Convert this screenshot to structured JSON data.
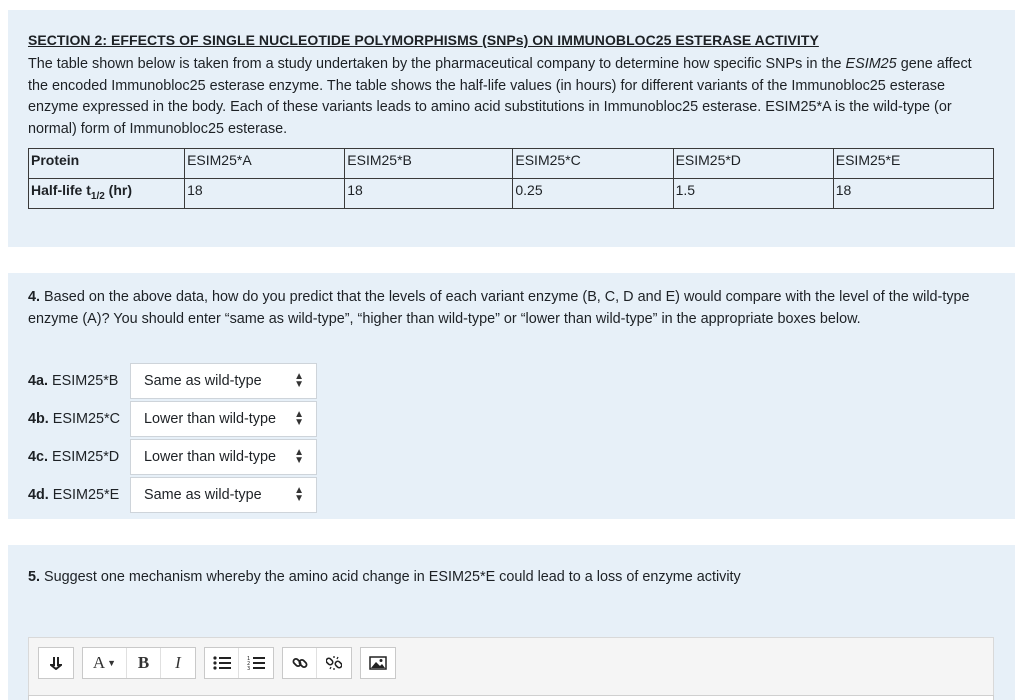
{
  "section2": {
    "title": "SECTION 2: EFFECTS OF SINGLE NUCLEOTIDE POLYMORPHISMS (SNPs) ON IMMUNOBLOC25 ESTERASE ACTIVITY",
    "para_part1": "The table shown below is taken from a study undertaken by the pharmaceutical company to determine how specific SNPs in the ",
    "para_italic": "ESIM25",
    "para_part2": " gene affect the encoded Immunobloc25 esterase enzyme. The table shows the half-life values (in hours) for different variants of the Immunobloc25 esterase enzyme expressed in the body. Each of these variants leads to amino acid substitutions in Immunobloc25 esterase. ESIM25*A is the wild-type (or normal) form of Immunobloc25 esterase.",
    "table": {
      "row1_label": "Protein",
      "row2_label_main": "Half-life t",
      "row2_label_sub": "1/2",
      "row2_label_end": " (hr)",
      "proteins": [
        "ESIM25*A",
        "ESIM25*B",
        "ESIM25*C",
        "ESIM25*D",
        "ESIM25*E"
      ],
      "half_lives": [
        "18",
        "18",
        "0.25",
        "1.5",
        "18"
      ]
    }
  },
  "q4": {
    "number": "4.",
    "text": " Based on the above data, how do you predict that the levels of each variant enzyme (B, C, D and E) would compare with the level of the wild-type enzyme (A)? You should enter “same as wild-type”, “higher than wild-type” or “lower than wild-type” in the appropriate boxes below.",
    "items": [
      {
        "num": "4a.",
        "label": " ESIM25*B",
        "value": "Same as wild-type"
      },
      {
        "num": "4b.",
        "label": " ESIM25*C",
        "value": "Lower than wild-type"
      },
      {
        "num": "4c.",
        "label": " ESIM25*D",
        "value": "Lower than wild-type"
      },
      {
        "num": "4d.",
        "label": " ESIM25*E",
        "value": "Same as wild-type"
      }
    ]
  },
  "q5": {
    "number": "5.",
    "text": " Suggest one mechanism whereby the amino acid change in ESIM25*E could lead to a loss of enzyme activity"
  },
  "toolbar": {
    "collapse": "↴",
    "font": "A▾",
    "bold": "B",
    "italic": "I",
    "ul": "☰",
    "ol": "☰",
    "link": "⚭",
    "unlink": "✂",
    "image": "▨",
    "icons": [
      "collapse-icon",
      "font-style-icon",
      "bold-icon",
      "italic-icon",
      "unordered-list-icon",
      "ordered-list-icon",
      "link-icon",
      "unlink-icon",
      "image-icon"
    ]
  }
}
